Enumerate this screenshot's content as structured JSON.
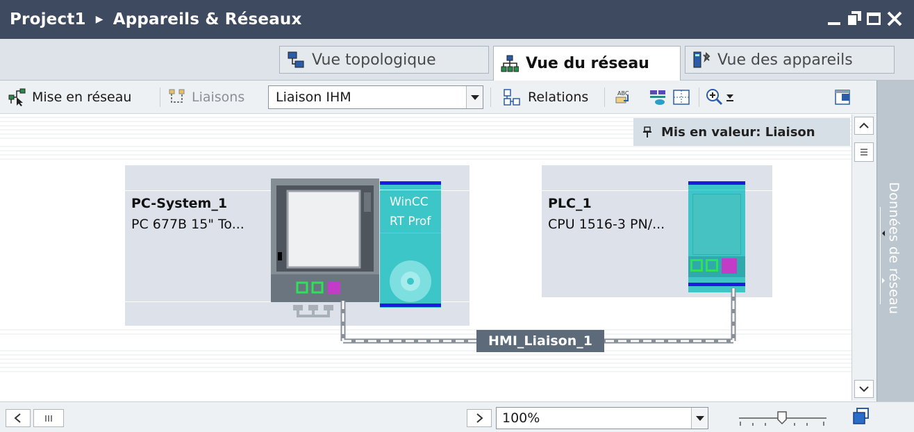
{
  "titlebar": {
    "project": "Project1",
    "section": "Appareils & Réseaux"
  },
  "tabs": [
    {
      "label": "Vue topologique",
      "icon": "topology-icon",
      "active": false
    },
    {
      "label": "Vue du réseau",
      "icon": "network-icon",
      "active": true
    },
    {
      "label": "Vue des appareils",
      "icon": "device-icon",
      "active": false
    }
  ],
  "toolbar": {
    "network_label": "Mise en réseau",
    "connections_label": "Liaisons",
    "connection_type": "Liaison IHM",
    "relations_label": "Relations"
  },
  "canvas": {
    "highlight_tooltip": "Mis en valeur: Liaison",
    "devices": [
      {
        "name": "PC-System_1",
        "type": "PC 677B 15\" To...",
        "software_line1": "WinCC",
        "software_line2": "RT Prof"
      },
      {
        "name": "PLC_1",
        "type": "CPU 1516-3 PN/..."
      }
    ],
    "connection_label": "HMI_Liaison_1"
  },
  "side_panel": {
    "label": "Données de réseau"
  },
  "bottom": {
    "zoom": "100%"
  },
  "colors": {
    "titlebar": "#3d4a5f",
    "rack": "#dde2ea",
    "device_teal": "#3cc6c8",
    "port_green": "#2ee05a",
    "port_magenta": "#c23cc8",
    "profinet_blue": "#1a1ae0",
    "connection_label_bg": "#5c6a7a"
  }
}
